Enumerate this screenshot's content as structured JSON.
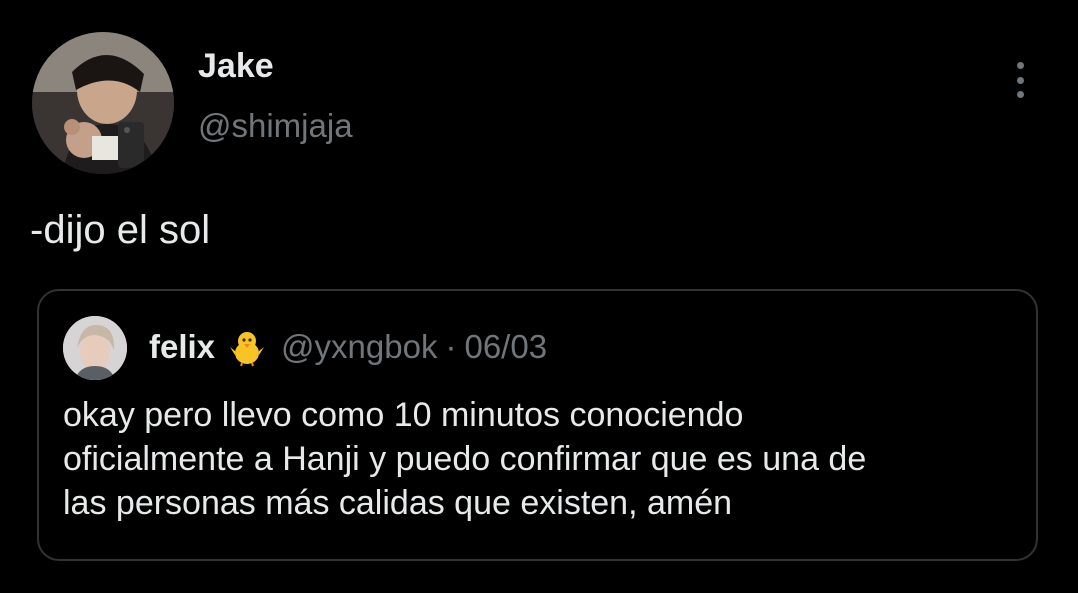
{
  "tweet": {
    "author_name": "Jake",
    "author_handle": "@shimjaja",
    "text": "-dijo el sol",
    "more_icon": "more-vertical-icon"
  },
  "quoted_tweet": {
    "author_name": "felix",
    "emoji": "🐥",
    "author_handle": "@yxngbok",
    "separator": "·",
    "date": "06/03",
    "text_lines": [
      "okay pero llevo como 10 minutos conociendo",
      "oficialmente a Hanji y puedo confirmar que es una de",
      "las personas más calidas que existen, amén"
    ]
  },
  "colors": {
    "background": "#000000",
    "primary_text": "#e7e9ea",
    "secondary_text": "#71767b",
    "card_border": "#2f3336"
  }
}
